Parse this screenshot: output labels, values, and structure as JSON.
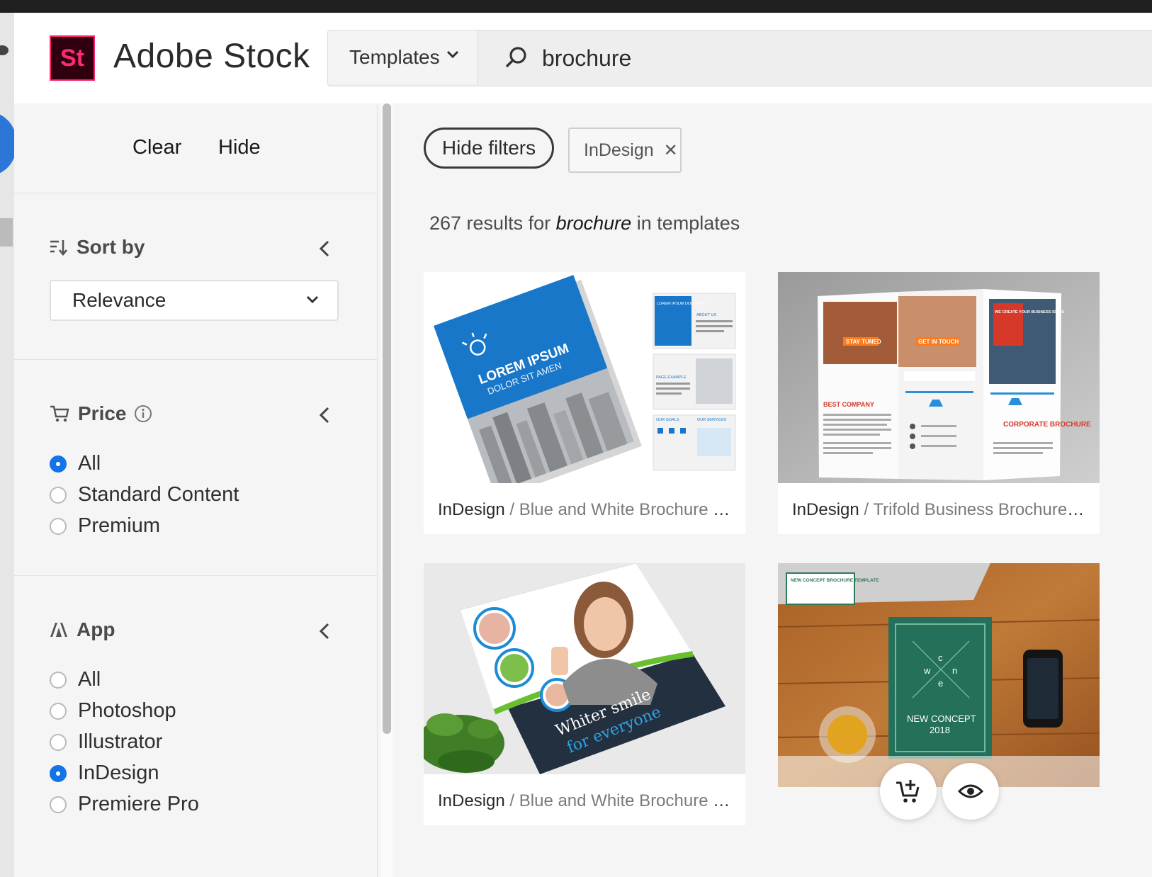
{
  "header": {
    "logo_text": "St",
    "brand": "Adobe Stock",
    "search_type": "Templates",
    "search_value": "brochure"
  },
  "sidebar": {
    "clear_label": "Clear",
    "hide_label": "Hide",
    "sort": {
      "title": "Sort by",
      "selected": "Relevance"
    },
    "price": {
      "title": "Price",
      "options": [
        "All",
        "Standard Content",
        "Premium"
      ],
      "selected": "All"
    },
    "app": {
      "title": "App",
      "options": [
        "All",
        "Photoshop",
        "Illustrator",
        "InDesign",
        "Premiere Pro"
      ],
      "selected": "InDesign"
    }
  },
  "main": {
    "hide_filters_label": "Hide filters",
    "active_filter": "InDesign",
    "results": {
      "count_prefix": "267 results for",
      "query": "brochure",
      "suffix": "in templates"
    },
    "cards": [
      {
        "app": "InDesign",
        "title": "Blue and White Brochure Layo...",
        "cover_title": "LOREM IPSUM",
        "cover_subtitle": "DOLOR SIT AMEN",
        "page_labels": [
          "LOREM IPSUM DOLOR SIT",
          "ABOUT US",
          "PAGE EXAMPLE",
          "OUR GOALS",
          "OUR SERVICES"
        ]
      },
      {
        "app": "InDesign",
        "title": "Trifold Business Brochure Layout",
        "panel_texts": [
          "STAY TUNED",
          "GET IN TOUCH",
          "WE CREATE YOUR BUSINESS IDEAS",
          "BEST COMPANY",
          "CORPORATE BROCHURE"
        ]
      },
      {
        "app": "InDesign",
        "title": "Blue and White Brochure Layout",
        "cover_line1": "Whiter smile",
        "cover_line2": "for everyone"
      },
      {
        "app": "",
        "title": "",
        "label_card": "NEW CONCEPT BROCHURE TEMPLATE",
        "cover_letters": [
          "c",
          "w",
          "n",
          "e"
        ],
        "cover_title": "NEW CONCEPT",
        "cover_year": "2018"
      }
    ]
  },
  "colors": {
    "brand_pink": "#ff1f6d",
    "logo_bg": "#31000e",
    "accent_blue": "#1473e6"
  }
}
